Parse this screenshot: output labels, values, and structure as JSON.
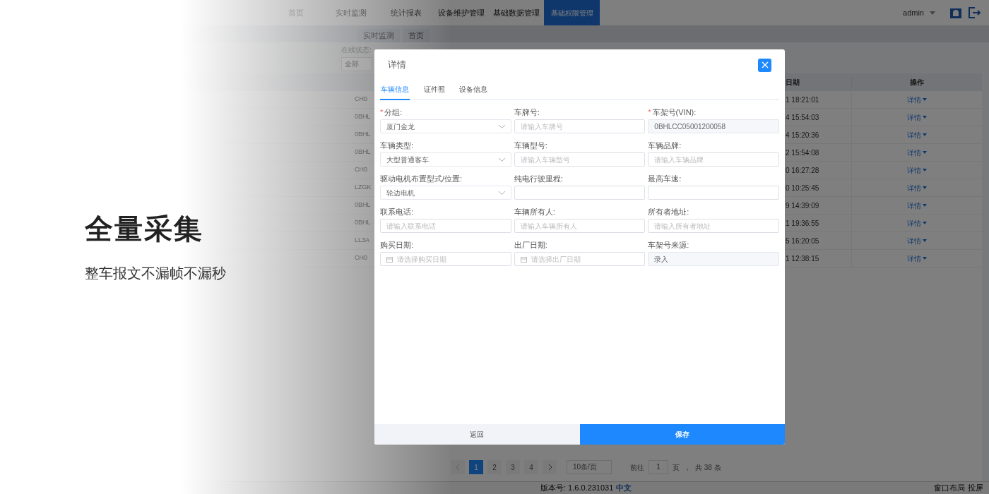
{
  "nav": {
    "items": [
      {
        "label": "首页",
        "selected": false
      },
      {
        "label": "实时监测",
        "selected": false
      },
      {
        "label": "统计报表",
        "selected": false
      },
      {
        "label": "设备维护管理",
        "selected": false
      },
      {
        "label": "基础数据管理",
        "selected": false
      },
      {
        "label": "基础权限管理",
        "selected": true
      }
    ],
    "user": "admin"
  },
  "page_tabs": [
    "实时监测",
    "首页"
  ],
  "filter": {
    "label": "在线状态:",
    "value": "全部"
  },
  "table": {
    "columns": [
      "日期",
      "操作"
    ],
    "rows": [
      {
        "column_2": "CH0",
        "date": "1 18:21:01",
        "action": "详情"
      },
      {
        "column_2": "0BHL",
        "date": "4 15:54:03",
        "action": "详情"
      },
      {
        "column_2": "0BHL",
        "date": "4 15:20:36",
        "action": "详情"
      },
      {
        "column_2": "0BHL",
        "date": "2 15:54:08",
        "action": "详情"
      },
      {
        "column_2": "CH0",
        "date": "0 16:27:28",
        "action": "详情"
      },
      {
        "column_2": "LZGK",
        "date": "0 10:25:45",
        "action": "详情"
      },
      {
        "column_2": "0BHL",
        "date": "9 14:39:09",
        "action": "详情"
      },
      {
        "column_2": "0BHL",
        "date": "1 19:36:55",
        "action": "详情"
      },
      {
        "column_2": "LL3A",
        "date": "5 16:20:05",
        "action": "详情"
      },
      {
        "column_2": "CH0",
        "date": "1 12:38:15",
        "action": "详情"
      }
    ]
  },
  "pagination": {
    "pages": [
      {
        "label": "1",
        "selected": true
      },
      {
        "label": "2",
        "selected": false
      },
      {
        "label": "3",
        "selected": false
      },
      {
        "label": "4",
        "selected": false
      }
    ],
    "page_size": "10条/页",
    "goto_label": "前往",
    "goto_value": "1",
    "goto_unit": "页",
    "separator": "，",
    "total": "共 38 条"
  },
  "footer": {
    "version": "版本号: 1.6.0.231031",
    "language": "中文",
    "tools": [
      "窗口布局",
      "投屏"
    ]
  },
  "dialog": {
    "title": "详情",
    "required_mark": "*",
    "tabs": [
      {
        "label": "车辆信息",
        "selected": true
      },
      {
        "label": "证件照",
        "selected": false
      },
      {
        "label": "设备信息",
        "selected": false
      }
    ],
    "fields": [
      {
        "label": "分组:",
        "required": true,
        "kind": "select",
        "value": "厦门金龙"
      },
      {
        "label": "车牌号:",
        "required": false,
        "kind": "input",
        "placeholder": "请输入车牌号"
      },
      {
        "label": "车架号(VIN):",
        "required": true,
        "kind": "readonly",
        "value": "0BHLCC05001200058"
      },
      {
        "label": "车辆类型:",
        "required": false,
        "kind": "select",
        "value": "大型普通客车"
      },
      {
        "label": "车辆型号:",
        "required": false,
        "kind": "input",
        "placeholder": "请输入车辆型号"
      },
      {
        "label": "车辆品牌:",
        "required": false,
        "kind": "input",
        "placeholder": "请输入车辆品牌"
      },
      {
        "label": "驱动电机布置型式/位置:",
        "required": false,
        "kind": "select",
        "value": "轮边电机"
      },
      {
        "label": "纯电行驶里程:",
        "required": false,
        "kind": "input"
      },
      {
        "label": "最高车速:",
        "required": false,
        "kind": "input"
      },
      {
        "label": "联系电话:",
        "required": false,
        "kind": "input",
        "placeholder": "请输入联系电话"
      },
      {
        "label": "车辆所有人:",
        "required": false,
        "kind": "input",
        "placeholder": "请输入车辆所有人"
      },
      {
        "label": "所有者地址:",
        "required": false,
        "kind": "input",
        "placeholder": "请输入所有者地址"
      },
      {
        "label": "购买日期:",
        "required": false,
        "kind": "date",
        "placeholder": "请选择购买日期"
      },
      {
        "label": "出厂日期:",
        "required": false,
        "kind": "date",
        "placeholder": "请选择出厂日期"
      },
      {
        "label": "车架号来源:",
        "required": false,
        "kind": "readonly",
        "value": "录入"
      }
    ],
    "buttons": [
      {
        "label": "返回",
        "kind": "secondary"
      },
      {
        "label": "保存",
        "kind": "primary"
      }
    ]
  },
  "promo": {
    "title": "全量采集",
    "subtitle": "整车报文不漏帧不漏秒"
  }
}
